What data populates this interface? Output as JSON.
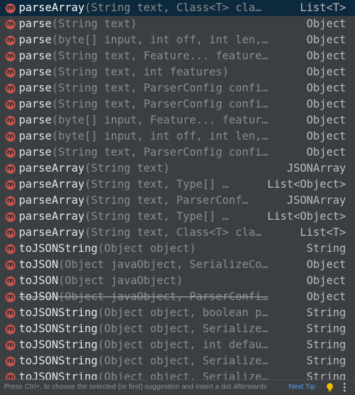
{
  "icon_letter": "m",
  "colors": {
    "method_icon": "#c75450",
    "selection": "#0d293e",
    "link": "#589df6",
    "bulb": "#f0c000"
  },
  "items": [
    {
      "name": "parseArray",
      "params": "(String text, Class<T> cla…",
      "ret": "List<T>",
      "selected": true
    },
    {
      "name": "parse",
      "params": "(String text)",
      "ret": "Object"
    },
    {
      "name": "parse",
      "params": "(byte[] input, int off, int len,…",
      "ret": "Object"
    },
    {
      "name": "parse",
      "params": "(String text, Feature... feature…",
      "ret": "Object"
    },
    {
      "name": "parse",
      "params": "(String text, int features)",
      "ret": "Object"
    },
    {
      "name": "parse",
      "params": "(String text, ParserConfig confi…",
      "ret": "Object"
    },
    {
      "name": "parse",
      "params": "(String text, ParserConfig confi…",
      "ret": "Object"
    },
    {
      "name": "parse",
      "params": "(byte[] input, Feature... featur…",
      "ret": "Object"
    },
    {
      "name": "parse",
      "params": "(byte[] input, int off, int len,…",
      "ret": "Object"
    },
    {
      "name": "parse",
      "params": "(String text, ParserConfig confi…",
      "ret": "Object"
    },
    {
      "name": "parseArray",
      "params": "(String text)",
      "ret": "JSONArray"
    },
    {
      "name": "parseArray",
      "params": "(String text, Type[] …",
      "ret": "List<Object>"
    },
    {
      "name": "parseArray",
      "params": "(String text, ParserConf…",
      "ret": "JSONArray"
    },
    {
      "name": "parseArray",
      "params": "(String text, Type[] …",
      "ret": "List<Object>"
    },
    {
      "name": "parseArray",
      "params": "(String text, Class<T> cla…",
      "ret": "List<T>"
    },
    {
      "name": "toJSONString",
      "params": "(Object object)",
      "ret": "String"
    },
    {
      "name": "toJSON",
      "params": "(Object javaObject, SerializeCo…",
      "ret": "Object"
    },
    {
      "name": "toJSON",
      "params": "(Object javaObject)",
      "ret": "Object"
    },
    {
      "name": "toJSON",
      "params": "(Object javaObject, ParserConfi…",
      "ret": "Object",
      "deprecated": true
    },
    {
      "name": "toJSONString",
      "params": "(Object object, boolean p…",
      "ret": "String"
    },
    {
      "name": "toJSONString",
      "params": "(Object object, Serialize…",
      "ret": "String"
    },
    {
      "name": "toJSONString",
      "params": "(Object object, int defau…",
      "ret": "String"
    },
    {
      "name": "toJSONString",
      "params": "(Object object, Serialize…",
      "ret": "String"
    },
    {
      "name": "toJSONString",
      "params": "(Object object, Serialize…",
      "ret": "String"
    }
  ],
  "footer": {
    "hint": "Press Ctrl+. to choose the selected (or first) suggestion and insert a dot afterwards",
    "next_tip": "Next Tip",
    "bulb_icon": "lightbulb-icon",
    "menu_icon": "more-vertical-icon"
  }
}
